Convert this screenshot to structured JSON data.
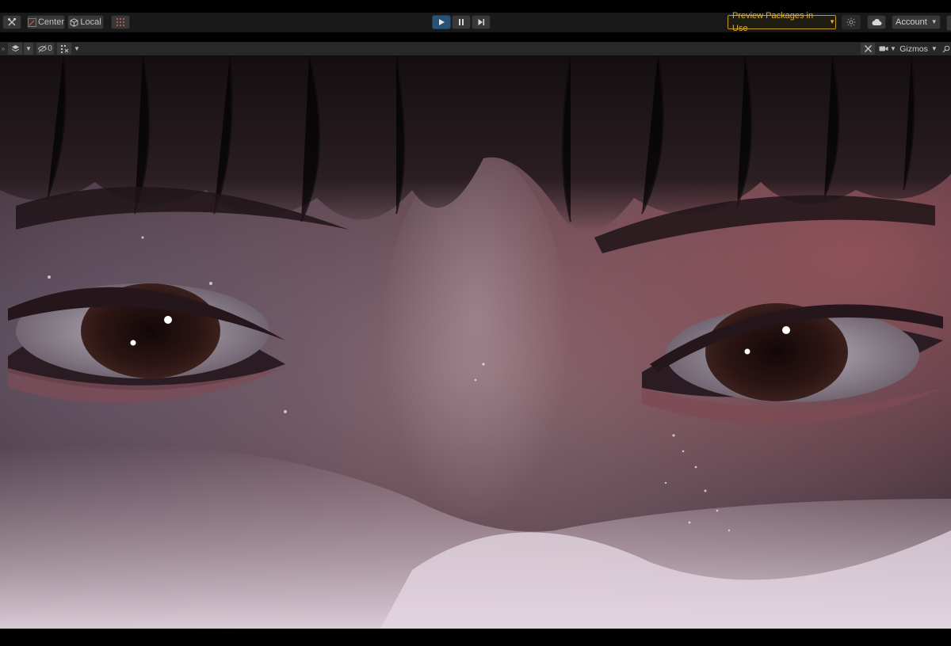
{
  "toolbar": {
    "pivot_label": "Center",
    "space_label": "Local",
    "preview_packages_label": "Preview Packages in Use",
    "account_label": "Account"
  },
  "scene_toolbar": {
    "hidden_count": "0",
    "gizmos_label": "Gizmos"
  },
  "icons": {
    "tools": "tools-icon",
    "pivot": "pivot-center-icon",
    "space": "local-space-cube-icon",
    "grid": "grid-snap-icon",
    "play": "play-icon",
    "pause": "pause-icon",
    "step": "step-icon",
    "lighting": "lighting-sun-icon",
    "cloud": "cloud-icon",
    "layers": "layers-icon",
    "visibility": "eye-slash-icon",
    "snap": "snap-increment-icon",
    "scene_tools": "scene-tools-icon",
    "camera": "camera-icon",
    "search": "search-icon"
  },
  "colors": {
    "accent_play": "#2a5274",
    "preview_warning": "#e2b02a",
    "toolbar_bg": "#191919",
    "scene_toolbar_bg": "#282828"
  }
}
